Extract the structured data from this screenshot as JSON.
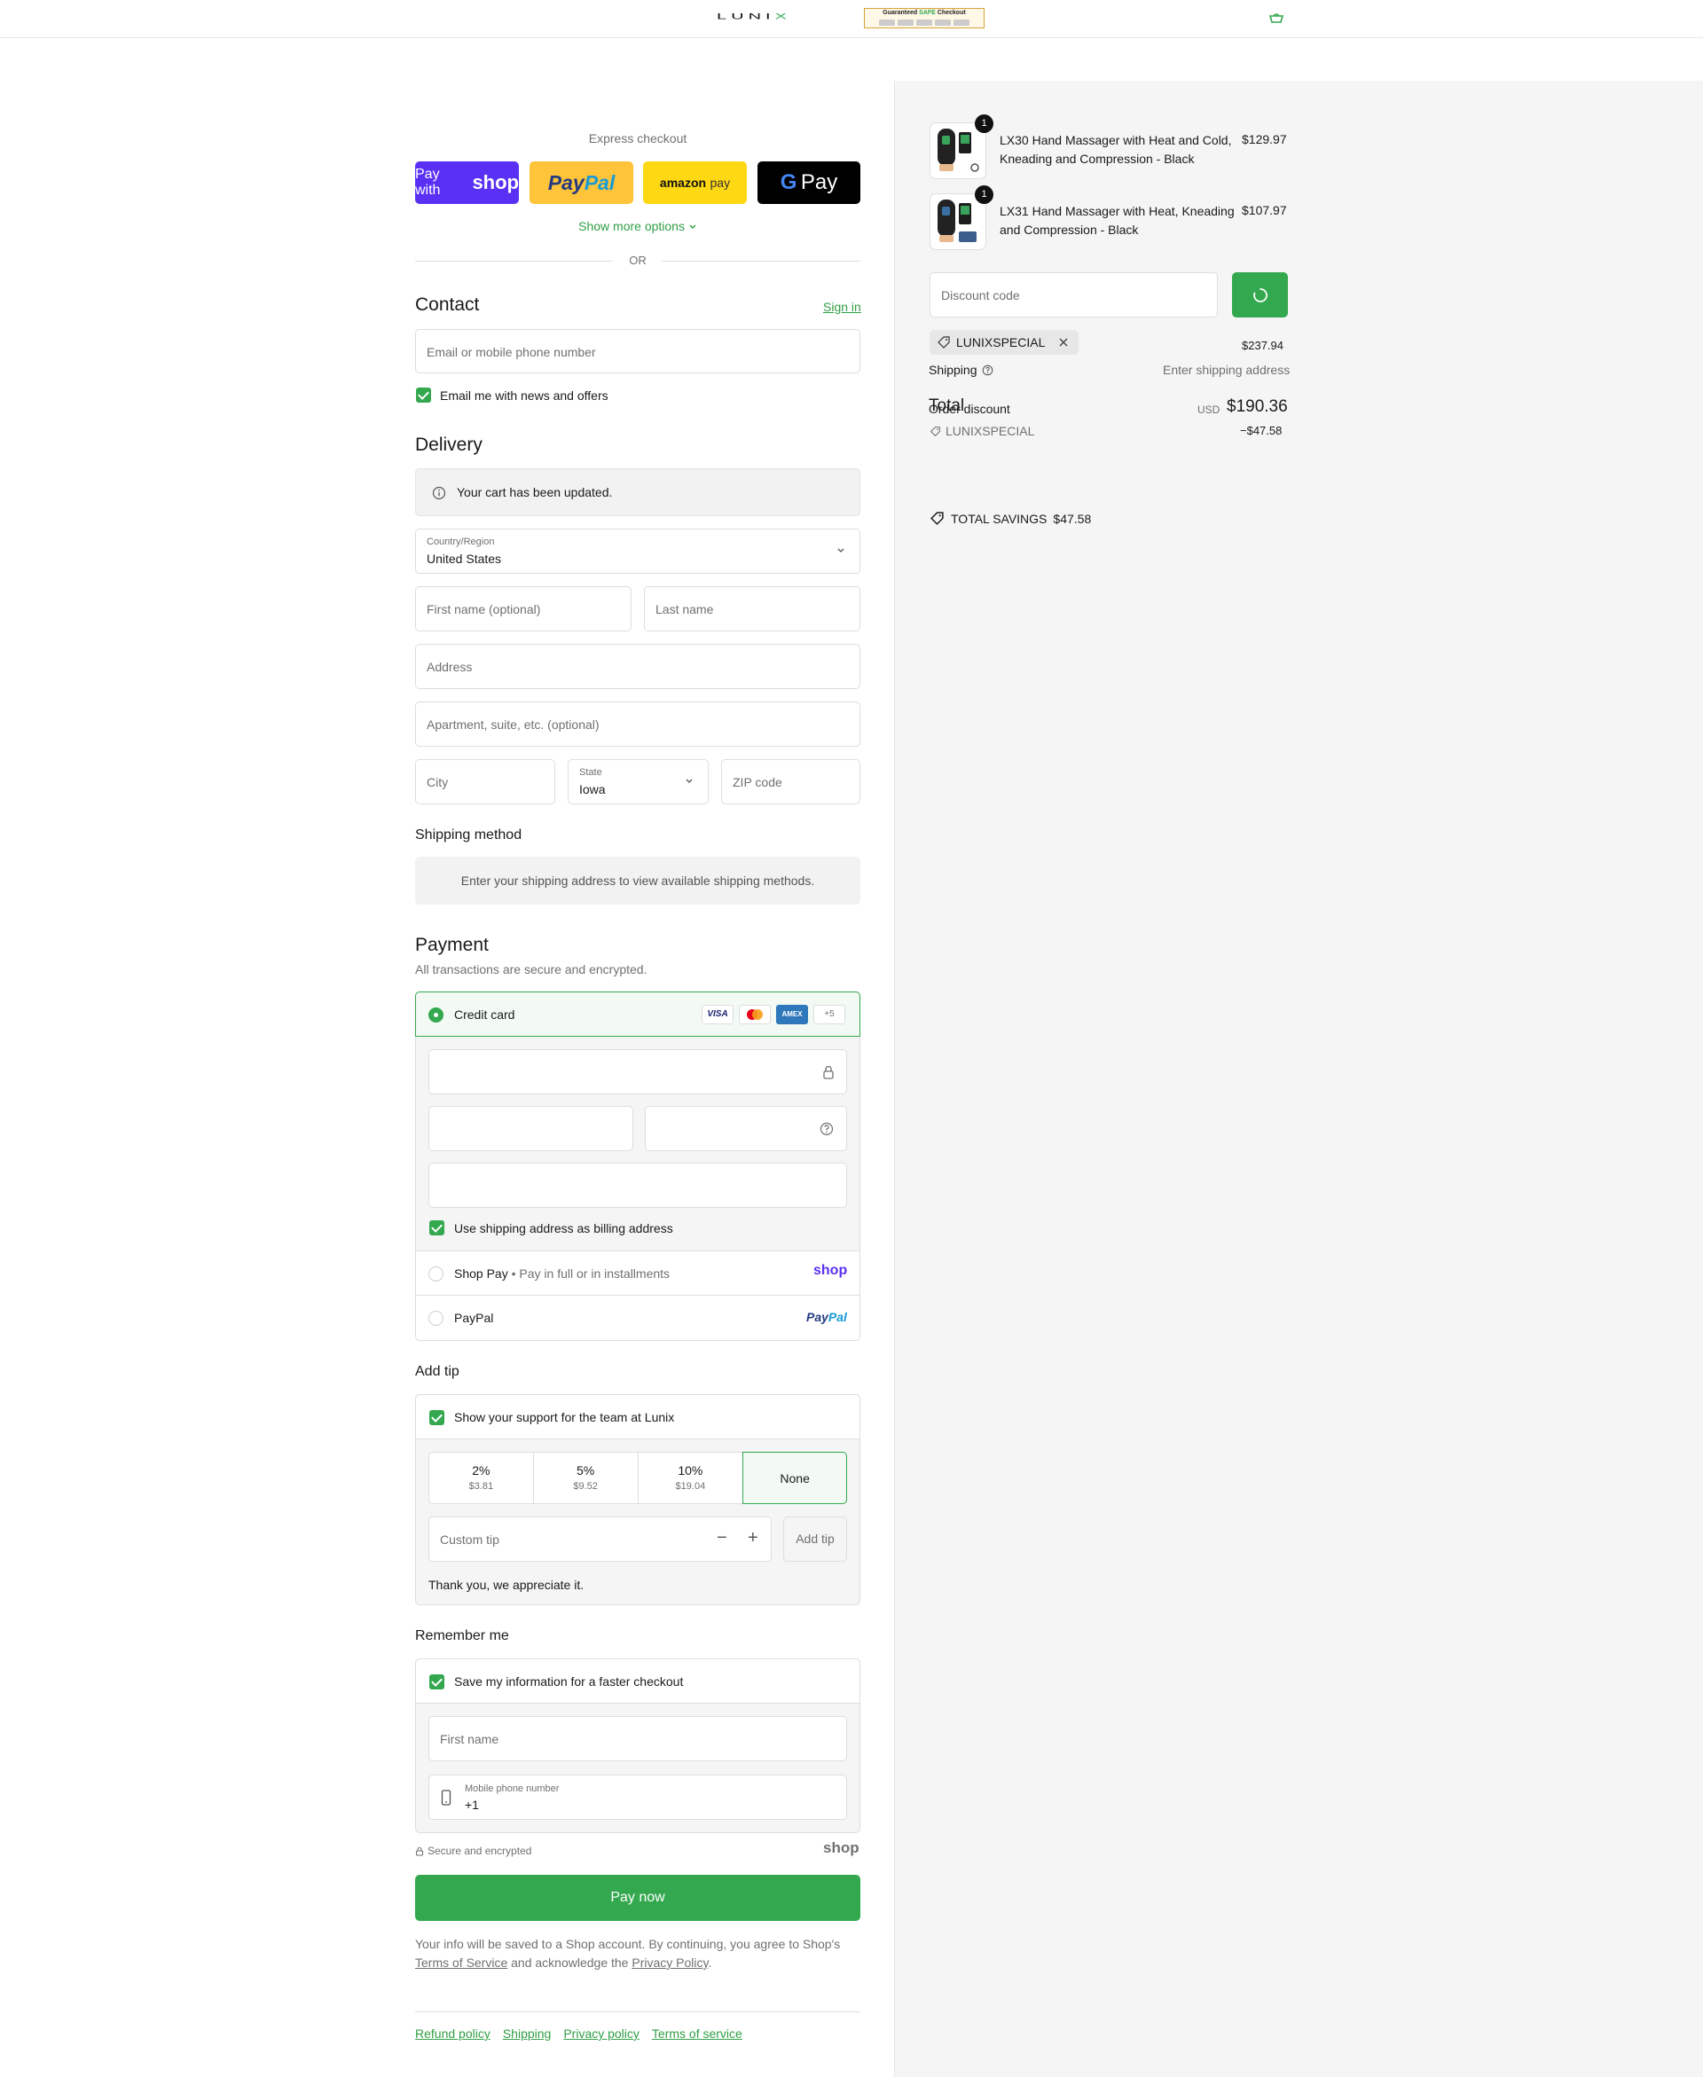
{
  "header": {
    "logo_main": "LUNI",
    "logo_accent": "X",
    "badge_top": "Guaranteed",
    "badge_accent": "SAFE",
    "badge_rest": "Checkout"
  },
  "express": {
    "title": "Express checkout",
    "shop_prefix": "Pay with",
    "shop_brand": "shop",
    "paypal_a": "Pay",
    "paypal_b": "Pal",
    "amazon_a": "amazon",
    "amazon_b": "pay",
    "gpay_g": "G",
    "gpay_text": "Pay",
    "show_more": "Show more options",
    "or": "OR"
  },
  "contact": {
    "title": "Contact",
    "sign_in": "Sign in",
    "email_placeholder": "Email or mobile phone number",
    "news_label": "Email me with news and offers"
  },
  "delivery": {
    "title": "Delivery",
    "notice": "Your cart has been updated.",
    "country_label": "Country/Region",
    "country_value": "United States",
    "first_name": "First name (optional)",
    "last_name": "Last name",
    "address": "Address",
    "apartment": "Apartment, suite, etc. (optional)",
    "city": "City",
    "state_label": "State",
    "state_value": "Iowa",
    "zip": "ZIP code"
  },
  "shipping_method": {
    "title": "Shipping method",
    "notice": "Enter your shipping address to view available shipping methods."
  },
  "payment": {
    "title": "Payment",
    "subtitle": "All transactions are secure and encrypted.",
    "credit_card": "Credit card",
    "cards": [
      "VISA",
      "AMEX"
    ],
    "more_cards": "+5",
    "billing_label": "Use shipping address as billing address",
    "shop_pay": "Shop Pay",
    "shop_pay_sub": "Pay in full or in installments",
    "shop_logo": "shop",
    "paypal": "PayPal",
    "paypal_logo_a": "Pay",
    "paypal_logo_b": "Pal"
  },
  "tip": {
    "title": "Add tip",
    "support_label": "Show your support for the team at Lunix",
    "options": [
      {
        "pct": "2%",
        "amt": "$3.81"
      },
      {
        "pct": "5%",
        "amt": "$9.52"
      },
      {
        "pct": "10%",
        "amt": "$19.04"
      }
    ],
    "none": "None",
    "custom_placeholder": "Custom tip",
    "minus": "−",
    "plus": "+",
    "add_tip": "Add tip",
    "thanks": "Thank you, we appreciate it."
  },
  "remember": {
    "title": "Remember me",
    "save_label": "Save my information for a faster checkout",
    "first_name": "First name",
    "phone_label": "Mobile phone number",
    "phone_value": "+1",
    "secure": "Secure and encrypted",
    "shop_logo": "shop"
  },
  "pay_now": "Pay now",
  "legal": {
    "line1": "Your info will be saved to a Shop account. By continuing, you agree to Shop's",
    "tos": "Terms of Service",
    "middle": "and acknowledge the",
    "privacy": "Privacy Policy",
    "end": "."
  },
  "footer_links": [
    "Refund policy",
    "Shipping",
    "Privacy policy",
    "Terms of service"
  ],
  "summary": {
    "items": [
      {
        "qty": "1",
        "name_line1": "LX30 Hand Massager with Heat and Cold,",
        "name_line2": "Kneading and Compression - Black",
        "price": "$129.97"
      },
      {
        "qty": "1",
        "name_line1": "LX31 Hand Massager with Heat, Kneading",
        "name_line2": "and Compression - Black",
        "price": "$107.97"
      }
    ],
    "discount_placeholder": "Discount code",
    "code": "LUNIXSPECIAL",
    "subtotal": "$237.94",
    "shipping_label": "Shipping",
    "shipping_value": "Enter shipping address",
    "total_label": "Total",
    "order_discount": "Order discount",
    "currency": "USD",
    "total": "$190.36",
    "discount_code": "LUNIXSPECIAL",
    "discount_amount": "−$47.58",
    "savings_label": "TOTAL SAVINGS",
    "savings_value": "$47.58"
  },
  "colors": {
    "accent": "#33a84f",
    "shop_purple": "#5a31f4",
    "paypal_yellow": "#ffc439",
    "text": "#1a1a1a",
    "muted": "#707070"
  }
}
